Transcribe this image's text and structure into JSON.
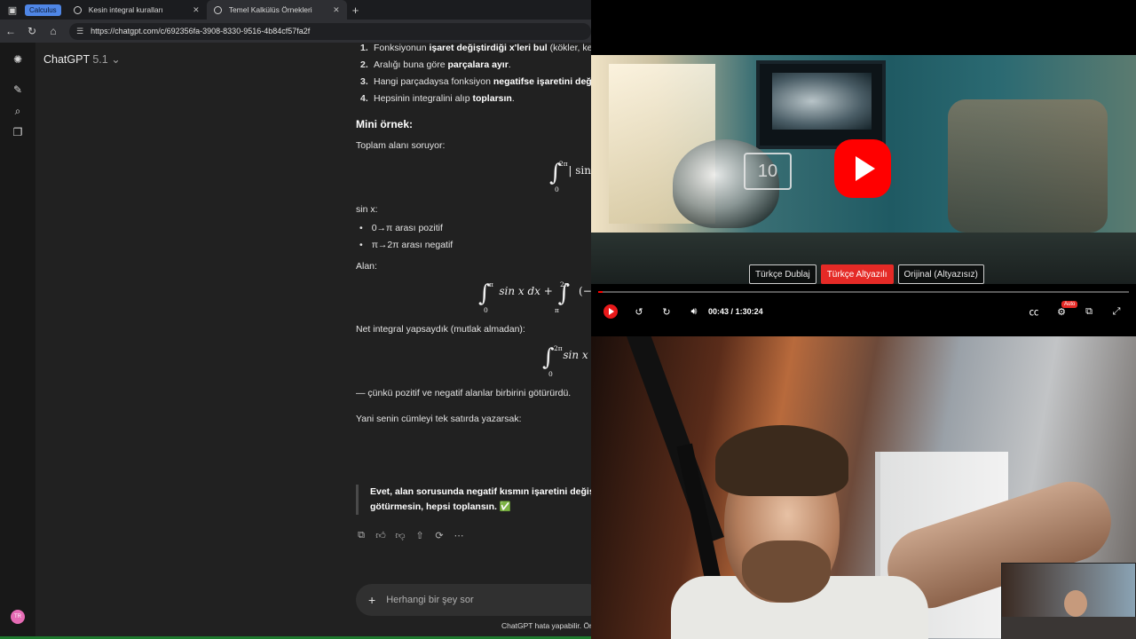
{
  "browser": {
    "tab_group": "Calculus",
    "tabs": [
      {
        "label": "Kesin integral kuralları"
      },
      {
        "label": "Temel Kalkülüs Örnekleri"
      }
    ],
    "url": "https://chatgpt.com/c/692356fa-3908-8330-9516-4b84cf57fa2f"
  },
  "chatgpt": {
    "model_name": "ChatGPT",
    "model_version": "5.1",
    "avatar_initials": "TR",
    "steps": [
      {
        "num": "1.",
        "pre": "Fonksiyonun ",
        "bold": "işaret değiştirdiği x'leri bul",
        "post": " (kökler, kes"
      },
      {
        "num": "2.",
        "pre": "Aralığı buna göre ",
        "bold": "parçalara ayır",
        "post": "."
      },
      {
        "num": "3.",
        "pre": "Hangi parçadaysa fonksiyon ",
        "bold": "negatifse işaretini deği",
        "post": ""
      },
      {
        "num": "4.",
        "pre": "Hepsinin integralini alıp ",
        "bold": "toplarsın",
        "post": "."
      }
    ],
    "mini_heading": "Mini örnek:",
    "p_total_area": "Toplam alanı soruyor:",
    "math1": {
      "upper": "2π",
      "lower": "0",
      "body": "| sin"
    },
    "p_sinx": "sin x:",
    "bullets": [
      "0→π arası pozitif",
      "π→2π arası negatif"
    ],
    "p_alan": "Alan:",
    "math2": {
      "u1": "π",
      "l1": "0",
      "body1": "sin x dx +",
      "u2": "2π",
      "l2": "π",
      "body2": "(− si"
    },
    "p_net": "Net integral yapsaydık (mutlak almadan):",
    "math3": {
      "upper": "2π",
      "lower": "0",
      "body": "sin x"
    },
    "p_because": "— çünkü pozitif ve negatif alanlar birbirini götürürdü.",
    "p_oneline": "Yani senin cümleyi tek satırda yazarsak:",
    "quote_line1": "Evet, alan sorusunda negatif kısmın işaretini değişt",
    "quote_line2": "götürmesin, hepsi toplansın. ✅",
    "composer_placeholder": "Herhangi bir şey sor",
    "footer_note": "ChatGPT hata yapabilir. Öne"
  },
  "video_player": {
    "rewind_label": "10",
    "languages": [
      {
        "label": "Türkçe Dublaj",
        "active": false
      },
      {
        "label": "Türkçe Altyazılı",
        "active": true
      },
      {
        "label": "Orijinal (Altyazısız)",
        "active": false
      }
    ],
    "current_time": "00:43",
    "separator": "/",
    "duration": "1:30:24",
    "progress_fraction": 0.008,
    "quality_badge": "Auto"
  }
}
